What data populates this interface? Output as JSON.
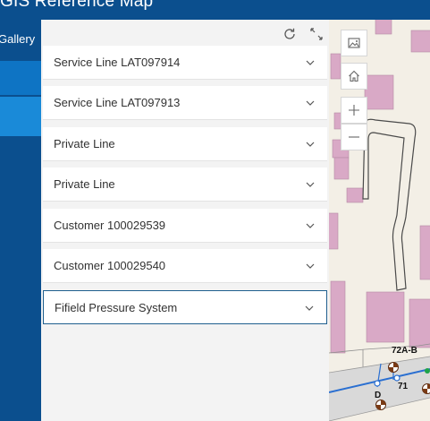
{
  "header": {
    "title": "GIS Reference Map"
  },
  "nav": {
    "gallery_label": "Gallery"
  },
  "panel": {
    "items": [
      {
        "label": "Service Line LAT097914"
      },
      {
        "label": "Service Line LAT097913"
      },
      {
        "label": "Private Line"
      },
      {
        "label": "Private Line"
      },
      {
        "label": "Customer 100029539"
      },
      {
        "label": "Customer 100029540"
      },
      {
        "label": "Fifield Pressure System"
      }
    ]
  },
  "map": {
    "labels": {
      "address": "72A-B",
      "number": "71",
      "letter": "D"
    },
    "colors": {
      "building": "#d9a9c6",
      "background": "#f3efe6",
      "road": "#d9d9d9",
      "line": "#2a6fd1"
    }
  }
}
